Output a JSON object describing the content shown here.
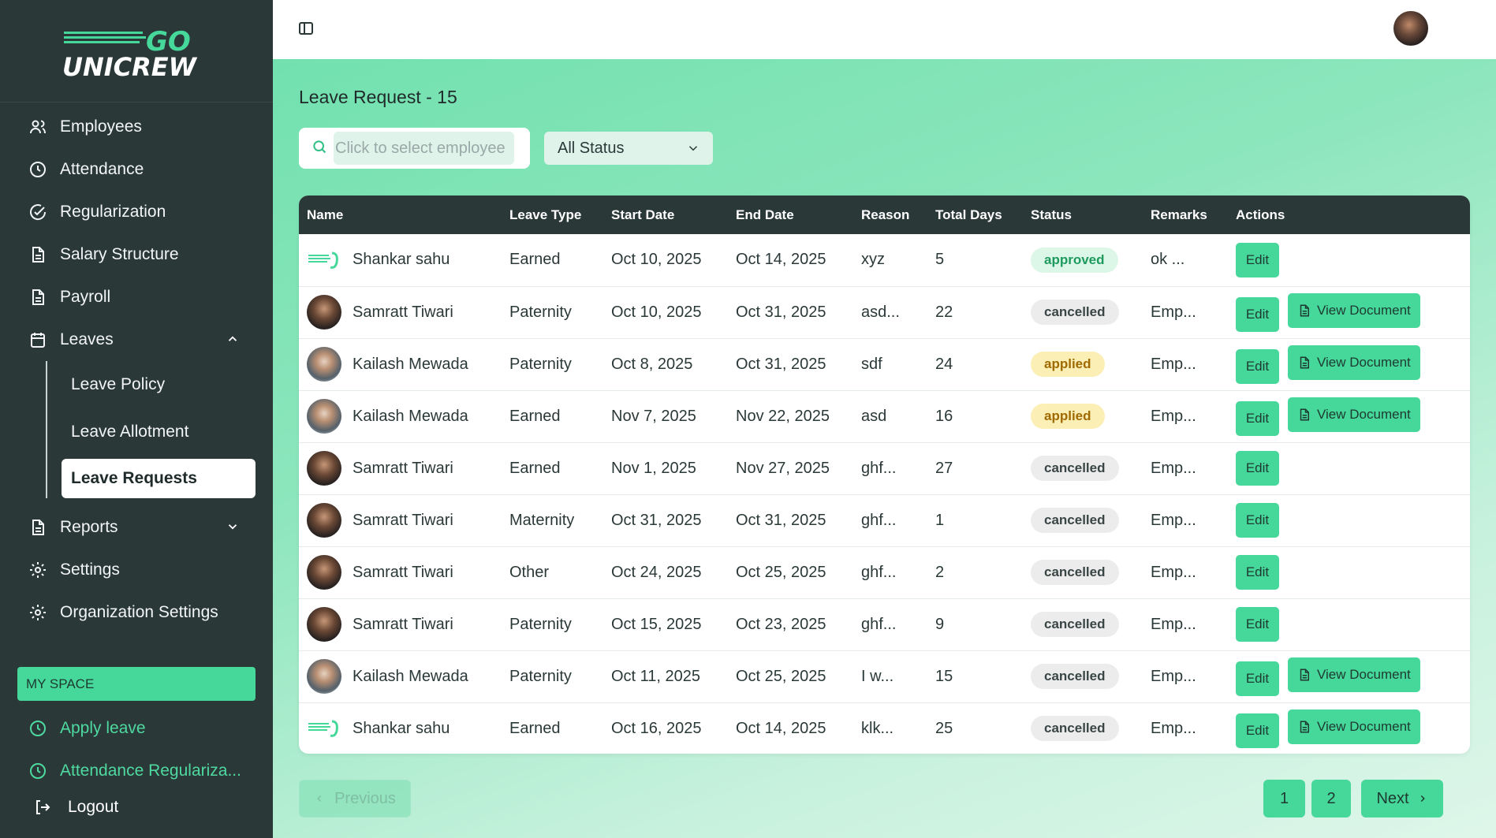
{
  "brand": {
    "line1": "GO",
    "line2": "UNICREW"
  },
  "sidebar": {
    "items": [
      {
        "label": "Employees",
        "icon": "users-icon"
      },
      {
        "label": "Attendance",
        "icon": "clock-icon"
      },
      {
        "label": "Regularization",
        "icon": "check-circle-icon"
      },
      {
        "label": "Salary Structure",
        "icon": "document-icon"
      },
      {
        "label": "Payroll",
        "icon": "document-icon"
      },
      {
        "label": "Leaves",
        "icon": "calendar-icon"
      }
    ],
    "leaves_sub": [
      "Leave Policy",
      "Leave Allotment",
      "Leave Requests"
    ],
    "items2": [
      {
        "label": "Reports",
        "icon": "document-icon"
      },
      {
        "label": "Settings",
        "icon": "gear-icon"
      },
      {
        "label": "Organization Settings",
        "icon": "gear-icon"
      }
    ],
    "my_space_label": "MY SPACE",
    "my_space_items": [
      "Apply leave",
      "Attendance Regulariza..."
    ],
    "logout": "Logout"
  },
  "page": {
    "title": "Leave Request - 15",
    "search_placeholder": "Click to select employee",
    "status_filter": "All Status"
  },
  "table": {
    "headers": [
      "Name",
      "Leave Type",
      "Start Date",
      "End Date",
      "Reason",
      "Total Days",
      "Status",
      "Remarks",
      "Actions"
    ],
    "edit_label": "Edit",
    "view_doc_label": "View Document",
    "rows": [
      {
        "name": "Shankar sahu",
        "avatar": "logo",
        "type": "Earned",
        "start": "Oct 10, 2025",
        "end": "Oct 14, 2025",
        "reason": "xyz",
        "days": "5",
        "status": "approved",
        "remarks": "ok ...",
        "doc": false
      },
      {
        "name": "Samratt Tiwari",
        "avatar": "a",
        "type": "Paternity",
        "start": "Oct 10, 2025",
        "end": "Oct 31, 2025",
        "reason": "asd...",
        "days": "22",
        "status": "cancelled",
        "remarks": "Emp...",
        "doc": true
      },
      {
        "name": "Kailash Mewada",
        "avatar": "b",
        "type": "Paternity",
        "start": "Oct 8, 2025",
        "end": "Oct 31, 2025",
        "reason": "sdf",
        "days": "24",
        "status": "applied",
        "remarks": "Emp...",
        "doc": true
      },
      {
        "name": "Kailash Mewada",
        "avatar": "b",
        "type": "Earned",
        "start": "Nov 7, 2025",
        "end": "Nov 22, 2025",
        "reason": "asd",
        "days": "16",
        "status": "applied",
        "remarks": "Emp...",
        "doc": true
      },
      {
        "name": "Samratt Tiwari",
        "avatar": "a",
        "type": "Earned",
        "start": "Nov 1, 2025",
        "end": "Nov 27, 2025",
        "reason": "ghf...",
        "days": "27",
        "status": "cancelled",
        "remarks": "Emp...",
        "doc": false
      },
      {
        "name": "Samratt Tiwari",
        "avatar": "a",
        "type": "Maternity",
        "start": "Oct 31, 2025",
        "end": "Oct 31, 2025",
        "reason": "ghf...",
        "days": "1",
        "status": "cancelled",
        "remarks": "Emp...",
        "doc": false
      },
      {
        "name": "Samratt Tiwari",
        "avatar": "a",
        "type": "Other",
        "start": "Oct 24, 2025",
        "end": "Oct 25, 2025",
        "reason": "ghf...",
        "days": "2",
        "status": "cancelled",
        "remarks": "Emp...",
        "doc": false
      },
      {
        "name": "Samratt Tiwari",
        "avatar": "a",
        "type": "Paternity",
        "start": "Oct 15, 2025",
        "end": "Oct 23, 2025",
        "reason": "ghf...",
        "days": "9",
        "status": "cancelled",
        "remarks": "Emp...",
        "doc": false
      },
      {
        "name": "Kailash Mewada",
        "avatar": "b",
        "type": "Paternity",
        "start": "Oct 11, 2025",
        "end": "Oct 25, 2025",
        "reason": "I w...",
        "days": "15",
        "status": "cancelled",
        "remarks": "Emp...",
        "doc": true
      },
      {
        "name": "Shankar sahu",
        "avatar": "logo",
        "type": "Earned",
        "start": "Oct 16, 2025",
        "end": "Oct 14, 2025",
        "reason": "klk...",
        "days": "25",
        "status": "cancelled",
        "remarks": "Emp...",
        "doc": true
      }
    ]
  },
  "pagination": {
    "previous": "Previous",
    "pages": [
      "1",
      "2"
    ],
    "next": "Next"
  },
  "colors": {
    "sidebar_bg": "#2b3838",
    "accent": "#46d79b",
    "accent_text": "#4ed9a0"
  }
}
